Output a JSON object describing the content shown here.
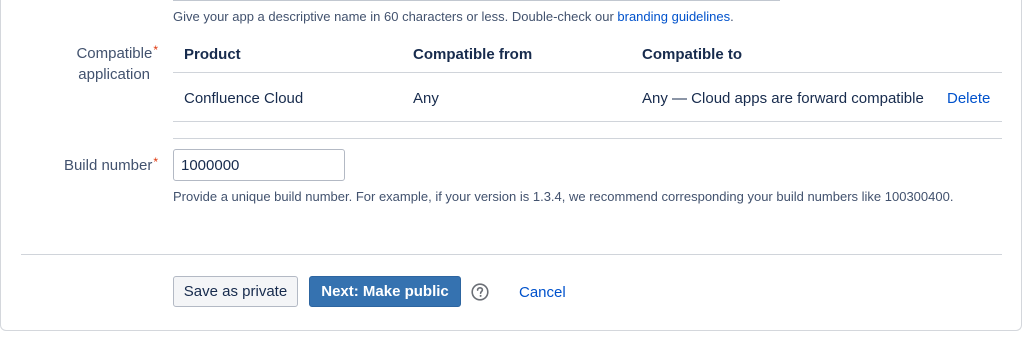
{
  "name_hint": {
    "text": "Give your app a descriptive name in 60 characters or less. Double-check our ",
    "link": "branding guidelines",
    "suffix": "."
  },
  "compatible": {
    "label_line1": "Compatible",
    "label_line2": "application",
    "required_mark": "*",
    "columns": [
      "Product",
      "Compatible from",
      "Compatible to"
    ],
    "rows": [
      {
        "product": "Confluence Cloud",
        "from": "Any",
        "to": "Any — Cloud apps are forward compatible",
        "action": "Delete"
      }
    ]
  },
  "build": {
    "label": "Build number",
    "required_mark": "*",
    "value": "1000000",
    "hint": "Provide a unique build number. For example, if your version is 1.3.4, we recommend corresponding your build numbers like 100300400."
  },
  "actions": {
    "save_private": "Save as private",
    "next_public": "Next: Make public",
    "help_icon": "question-circle-icon",
    "cancel": "Cancel"
  },
  "colors": {
    "primary": "#3572b0",
    "link": "#0052cc",
    "required": "#de350b"
  }
}
